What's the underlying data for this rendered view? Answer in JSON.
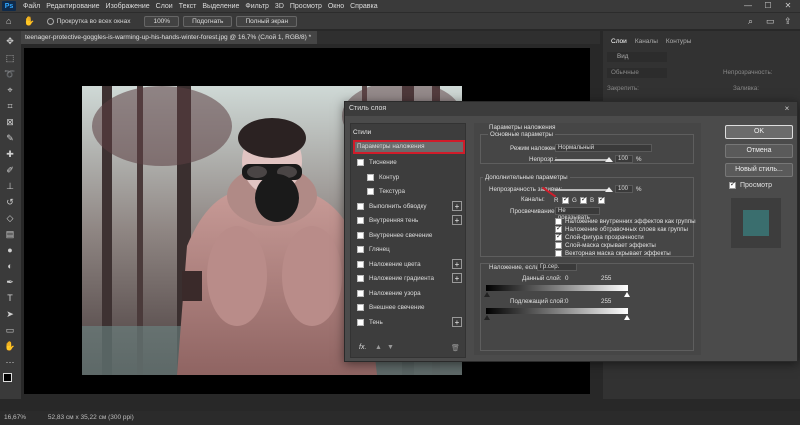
{
  "menu": {
    "logo": "Ps",
    "items": [
      "Файл",
      "Редактирование",
      "Изображение",
      "Слои",
      "Текст",
      "Выделение",
      "Фильтр",
      "3D",
      "Просмотр",
      "Окно",
      "Справка"
    ],
    "window_controls": [
      "—",
      "☐",
      "✕"
    ]
  },
  "options": {
    "scroll_all_windows": "Прокрутка во всех окнах",
    "zoom_100": "100%",
    "fit": "Подогнать",
    "fullscreen": "Полный экран"
  },
  "document": {
    "tab_title": "teenager-protective-goggles-is-warming-up-his-hands-winter-forest.jpg @ 16,7% (Слой 1, RGB/8) *",
    "close": "×"
  },
  "layers_panel": {
    "tabs": [
      "Слои",
      "Каналы",
      "Контуры"
    ],
    "kind": "Вид",
    "blend_mode": "Обычные",
    "opacity_label": "Непрозрачность:",
    "lock_label": "Закрепить:",
    "fill_label": "Заливка:"
  },
  "status": {
    "zoom": "16,67%",
    "doc_size": "52,83 см x 35,22 см (300 ppi)"
  },
  "dialog": {
    "title": "Стиль слоя",
    "close": "×",
    "styles_header": "Стили",
    "styles": [
      {
        "label": "Параметры наложения",
        "checkbox": false,
        "plus": false,
        "selected": true
      },
      {
        "label": "Тиснение",
        "checkbox": true,
        "plus": false
      },
      {
        "label": "Контур",
        "checkbox": true,
        "plus": false,
        "indent": true
      },
      {
        "label": "Текстура",
        "checkbox": true,
        "plus": false,
        "indent": true
      },
      {
        "label": "Выполнить обводку",
        "checkbox": true,
        "plus": true
      },
      {
        "label": "Внутренняя тень",
        "checkbox": true,
        "plus": true
      },
      {
        "label": "Внутреннее свечение",
        "checkbox": true,
        "plus": false
      },
      {
        "label": "Глянец",
        "checkbox": true,
        "plus": false
      },
      {
        "label": "Наложение цвета",
        "checkbox": true,
        "plus": true
      },
      {
        "label": "Наложение градиента",
        "checkbox": true,
        "plus": true
      },
      {
        "label": "Наложение узора",
        "checkbox": true,
        "plus": false
      },
      {
        "label": "Внешнее свечение",
        "checkbox": true,
        "plus": false
      },
      {
        "label": "Тень",
        "checkbox": true,
        "plus": true
      }
    ],
    "fx_label": "fx.",
    "blending": {
      "section_title": "Параметры наложения",
      "general_title": "Основные параметры",
      "blend_mode_label": "Режим наложения:",
      "blend_mode_value": "Нормальный",
      "opacity_label": "Непрозр.:",
      "opacity_value": "100",
      "percent": "%",
      "advanced_title": "Дополнительные параметры",
      "fill_opacity_label": "Непрозрачность заливки:",
      "fill_opacity_value": "100",
      "channels_label": "Каналы:",
      "channels": [
        "R",
        "G",
        "B"
      ],
      "knockout_label": "Просвечивание:",
      "knockout_value": "Не показывать",
      "options": [
        {
          "label": "Наложение внутренних эффектов как группы",
          "checked": false
        },
        {
          "label": "Наложение обтравочных слоев как группы",
          "checked": true
        },
        {
          "label": "Слой-фигура прозрачности",
          "checked": true
        },
        {
          "label": "Слой-маска скрывает эффекты",
          "checked": false
        },
        {
          "label": "Векторная маска скрывает эффекты",
          "checked": false
        }
      ],
      "blend_if_label": "Наложение, если:",
      "blend_if_value": "Гр.сер.",
      "this_layer_label": "Данный слой:",
      "underlying_label": "Подлежащий слой:",
      "range_min": "0",
      "range_max": "255"
    },
    "buttons": {
      "ok": "OK",
      "cancel": "Отмена",
      "new_style": "Новый стиль...",
      "preview": "Просмотр"
    },
    "preview_color": "#3a6e6e"
  },
  "colors": {
    "highlight": "#d01c2a"
  }
}
